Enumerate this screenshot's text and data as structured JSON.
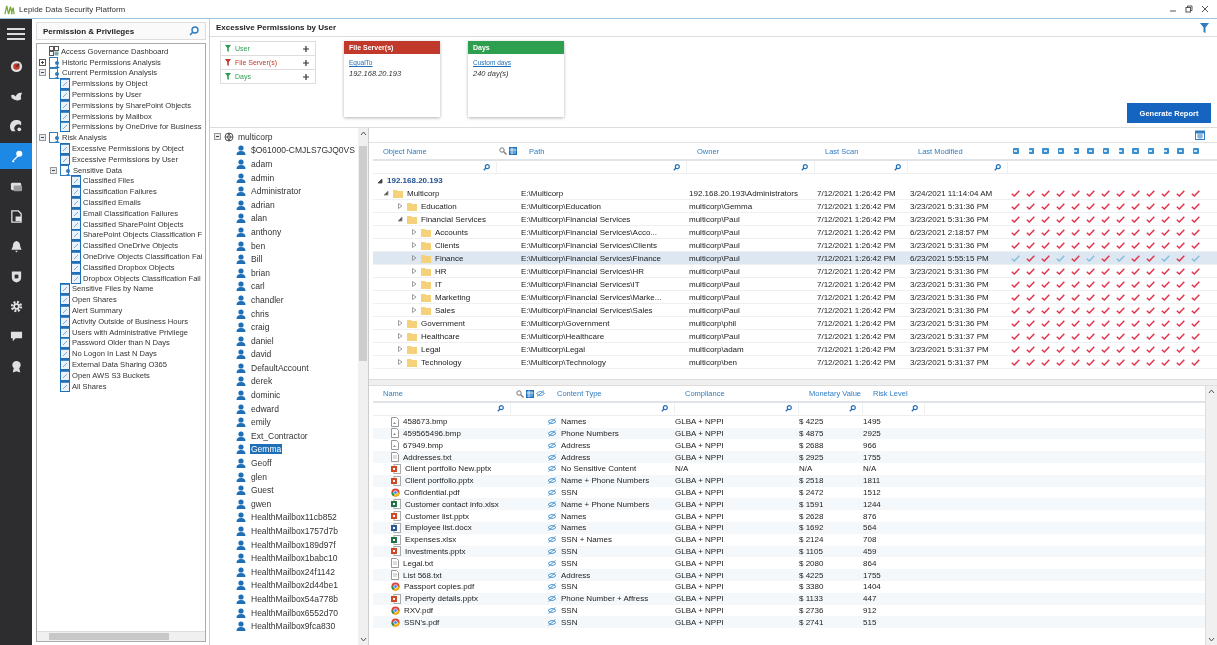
{
  "window": {
    "title": "Lepide Data Security Platform"
  },
  "nav": [
    {
      "kind": "gauge",
      "selected": false
    },
    {
      "kind": "bird",
      "selected": false
    },
    {
      "kind": "radar",
      "selected": false
    },
    {
      "kind": "key",
      "selected": true
    },
    {
      "kind": "database",
      "selected": false
    },
    {
      "kind": "report",
      "selected": false
    },
    {
      "kind": "bell",
      "selected": false
    },
    {
      "kind": "shield",
      "selected": false
    },
    {
      "kind": "gear",
      "selected": false
    },
    {
      "kind": "chat",
      "selected": false
    },
    {
      "kind": "badge",
      "selected": false
    }
  ],
  "left_panel": {
    "title": "Permission & Privileges",
    "tree": [
      {
        "label": "Access Governance Dashboard",
        "kind": "dashboard"
      },
      {
        "label": "Historic Permissions Analysis",
        "kind": "group",
        "expanded": false
      },
      {
        "label": "Current Permission Analysis",
        "kind": "group",
        "expanded": true,
        "children": [
          {
            "label": "Permissions by Object",
            "kind": "report"
          },
          {
            "label": "Permissions by User",
            "kind": "report"
          },
          {
            "label": "Permissions by SharePoint Objects",
            "kind": "report"
          },
          {
            "label": "Permissions by Mailbox",
            "kind": "report"
          },
          {
            "label": "Permissions by OneDrive for Business",
            "kind": "report"
          }
        ]
      },
      {
        "label": "Risk Analysis",
        "kind": "group",
        "expanded": true,
        "children": [
          {
            "label": "Excessive Permissions by Object",
            "kind": "report"
          },
          {
            "label": "Excessive Permissions by User",
            "kind": "report"
          },
          {
            "label": "Sensitive Data",
            "kind": "group",
            "expanded": true,
            "children": [
              {
                "label": "Classified Files",
                "kind": "report"
              },
              {
                "label": "Classification Failures",
                "kind": "report"
              },
              {
                "label": "Classified Emails",
                "kind": "report"
              },
              {
                "label": "Email Classification Failures",
                "kind": "report"
              },
              {
                "label": "Classified SharePoint Objects",
                "kind": "report"
              },
              {
                "label": "SharePoint Objects Classification F",
                "kind": "report"
              },
              {
                "label": "Classified OneDrive Objects",
                "kind": "report"
              },
              {
                "label": "OneDrive Objects Classification Fai",
                "kind": "report"
              },
              {
                "label": "Classified Dropbox Objects",
                "kind": "report"
              },
              {
                "label": "Dropbox Objects Classification Fail",
                "kind": "report"
              }
            ]
          },
          {
            "label": "Sensitive Files by Name",
            "kind": "report"
          },
          {
            "label": "Open Shares",
            "kind": "report"
          },
          {
            "label": "Alert Summary",
            "kind": "report"
          },
          {
            "label": "Activity Outside of Business Hours",
            "kind": "report"
          },
          {
            "label": "Users with Administrative Privilege",
            "kind": "report"
          },
          {
            "label": "Password Older than N Days",
            "kind": "report"
          },
          {
            "label": "No Logon In Last N Days",
            "kind": "report"
          },
          {
            "label": "External Data Sharing O365",
            "kind": "report"
          },
          {
            "label": "Open AWS S3 Buckets",
            "kind": "report"
          },
          {
            "label": "All Shares",
            "kind": "report"
          }
        ]
      }
    ]
  },
  "report": {
    "title": "Excessive Permissions by User",
    "filters": [
      {
        "label": "User",
        "color": "#2e9e4f"
      },
      {
        "label": "File Server(s)",
        "color": "#c0392b"
      },
      {
        "label": "Days",
        "color": "#2e9e4f"
      }
    ],
    "cards": [
      {
        "header": "File Server(s)",
        "color": "#c0392b",
        "operator": "EqualTo",
        "value": "192.168.20.193"
      },
      {
        "header": "Days",
        "color": "#2e9e4f",
        "operator": "Custom days",
        "value": "240 day(s)"
      }
    ],
    "generate_button": "Generate Report"
  },
  "users": {
    "root": "multicorp",
    "expanded": true,
    "items": [
      {
        "name": "$O61000-CMJLS7GJQ0VS",
        "selected": false
      },
      {
        "name": "adam",
        "selected": false
      },
      {
        "name": "admin",
        "selected": false
      },
      {
        "name": "Administrator",
        "selected": false
      },
      {
        "name": "adrian",
        "selected": false
      },
      {
        "name": "alan",
        "selected": false
      },
      {
        "name": "anthony",
        "selected": false
      },
      {
        "name": "ben",
        "selected": false
      },
      {
        "name": "Bill",
        "selected": false
      },
      {
        "name": "brian",
        "selected": false
      },
      {
        "name": "carl",
        "selected": false
      },
      {
        "name": "chandler",
        "selected": false
      },
      {
        "name": "chris",
        "selected": false
      },
      {
        "name": "craig",
        "selected": false
      },
      {
        "name": "daniel",
        "selected": false
      },
      {
        "name": "david",
        "selected": false
      },
      {
        "name": "DefaultAccount",
        "selected": false
      },
      {
        "name": "derek",
        "selected": false
      },
      {
        "name": "dominic",
        "selected": false
      },
      {
        "name": "edward",
        "selected": false
      },
      {
        "name": "emily",
        "selected": false
      },
      {
        "name": "Ext_Contractor",
        "selected": false
      },
      {
        "name": "Gemma",
        "selected": true
      },
      {
        "name": "Geoff",
        "selected": false
      },
      {
        "name": "glen",
        "selected": false
      },
      {
        "name": "Guest",
        "selected": false
      },
      {
        "name": "gwen",
        "selected": false
      },
      {
        "name": "HealthMailbox11cb852",
        "selected": false
      },
      {
        "name": "HealthMailbox1757d7b",
        "selected": false
      },
      {
        "name": "HealthMailbox189d97f",
        "selected": false
      },
      {
        "name": "HealthMailbox1babc10",
        "selected": false
      },
      {
        "name": "HealthMailbox24f1142",
        "selected": false
      },
      {
        "name": "HealthMailbox2d44be1",
        "selected": false
      },
      {
        "name": "HealthMailbox54a778b",
        "selected": false
      },
      {
        "name": "HealthMailbox6552d70",
        "selected": false
      },
      {
        "name": "HealthMailbox9fca830",
        "selected": false
      }
    ]
  },
  "objects": {
    "columns": [
      "Object Name",
      "Path",
      "Owner",
      "Last Scan",
      "Last Modified"
    ],
    "group": "192.168.20.193",
    "expanded": true,
    "rows": [
      {
        "name": "Multicorp",
        "path": "E:\\Multicorp",
        "owner": "192.168.20.193\\Administrators",
        "last_scan": "7/12/2021 1:26:42 PM",
        "last_modified": "3/24/2021 11:14:04 AM",
        "expanded": true,
        "selected": false,
        "checks": [
          true,
          true,
          true,
          true,
          true,
          true,
          true,
          true,
          true,
          true,
          true,
          true,
          true
        ],
        "children": [
          {
            "name": "Education",
            "path": "E:\\Multicorp\\Education",
            "owner": "multicorp\\Gemma",
            "last_scan": "7/12/2021 1:26:42 PM",
            "last_modified": "3/23/2021 5:31:36 PM",
            "expanded": false,
            "selected": false,
            "checks": [
              true,
              true,
              true,
              true,
              true,
              true,
              true,
              true,
              true,
              true,
              true,
              true,
              true
            ]
          },
          {
            "name": "Financial Services",
            "path": "E:\\Multicorp\\Financial Services",
            "owner": "multicorp\\Paul",
            "last_scan": "7/12/2021 1:26:42 PM",
            "last_modified": "3/23/2021 5:31:36 PM",
            "expanded": true,
            "selected": false,
            "checks": [
              true,
              true,
              true,
              true,
              true,
              true,
              true,
              true,
              true,
              true,
              true,
              true,
              true
            ],
            "children": [
              {
                "name": "Accounts",
                "path": "E:\\Multicorp\\Financial Services\\Acco...",
                "owner": "multicorp\\Paul",
                "last_scan": "7/12/2021 1:26:42 PM",
                "last_modified": "6/23/2021 2:18:57 PM",
                "expanded": false,
                "selected": false,
                "checks": [
                  true,
                  true,
                  true,
                  true,
                  true,
                  true,
                  true,
                  true,
                  true,
                  true,
                  true,
                  true,
                  true
                ]
              },
              {
                "name": "Clients",
                "path": "E:\\Multicorp\\Financial Services\\Clients",
                "owner": "multicorp\\Paul",
                "last_scan": "7/12/2021 1:26:42 PM",
                "last_modified": "3/23/2021 5:31:36 PM",
                "expanded": false,
                "selected": false,
                "checks": [
                  true,
                  true,
                  true,
                  true,
                  true,
                  true,
                  true,
                  true,
                  true,
                  true,
                  true,
                  true,
                  true
                ]
              },
              {
                "name": "Finance",
                "path": "E:\\Multicorp\\Financial Services\\Finance",
                "owner": "multicorp\\Paul",
                "last_scan": "7/12/2021 1:26:42 PM",
                "last_modified": "6/23/2021 5:55:15 PM",
                "expanded": false,
                "selected": true,
                "checks": [
                  false,
                  true,
                  true,
                  false,
                  true,
                  false,
                  true,
                  false,
                  true,
                  true,
                  false,
                  true,
                  false
                ]
              },
              {
                "name": "HR",
                "path": "E:\\Multicorp\\Financial Services\\HR",
                "owner": "multicorp\\Paul",
                "last_scan": "7/12/2021 1:26:42 PM",
                "last_modified": "3/23/2021 5:31:36 PM",
                "expanded": false,
                "selected": false,
                "checks": [
                  true,
                  true,
                  true,
                  true,
                  true,
                  true,
                  true,
                  true,
                  true,
                  true,
                  true,
                  true,
                  true
                ]
              },
              {
                "name": "IT",
                "path": "E:\\Multicorp\\Financial Services\\IT",
                "owner": "multicorp\\Paul",
                "last_scan": "7/12/2021 1:26:42 PM",
                "last_modified": "3/23/2021 5:31:36 PM",
                "expanded": false,
                "selected": false,
                "checks": [
                  true,
                  true,
                  true,
                  true,
                  true,
                  true,
                  true,
                  true,
                  true,
                  true,
                  true,
                  true,
                  true
                ]
              },
              {
                "name": "Marketing",
                "path": "E:\\Multicorp\\Financial Services\\Marke...",
                "owner": "multicorp\\Paul",
                "last_scan": "7/12/2021 1:26:42 PM",
                "last_modified": "3/23/2021 5:31:36 PM",
                "expanded": false,
                "selected": false,
                "checks": [
                  true,
                  true,
                  true,
                  true,
                  true,
                  true,
                  true,
                  true,
                  true,
                  true,
                  true,
                  true,
                  true
                ]
              },
              {
                "name": "Sales",
                "path": "E:\\Multicorp\\Financial Services\\Sales",
                "owner": "multicorp\\Paul",
                "last_scan": "7/12/2021 1:26:42 PM",
                "last_modified": "3/23/2021 5:31:36 PM",
                "expanded": false,
                "selected": false,
                "checks": [
                  true,
                  true,
                  true,
                  true,
                  true,
                  true,
                  true,
                  true,
                  true,
                  true,
                  true,
                  true,
                  true
                ]
              }
            ]
          },
          {
            "name": "Government",
            "path": "E:\\Multicorp\\Government",
            "owner": "multicorp\\phil",
            "last_scan": "7/12/2021 1:26:42 PM",
            "last_modified": "3/23/2021 5:31:36 PM",
            "expanded": false,
            "selected": false,
            "checks": [
              true,
              true,
              true,
              true,
              true,
              true,
              true,
              true,
              true,
              true,
              true,
              true,
              true
            ]
          },
          {
            "name": "Healthcare",
            "path": "E:\\Multicorp\\Healthcare",
            "owner": "multicorp\\Paul",
            "last_scan": "7/12/2021 1:26:42 PM",
            "last_modified": "3/23/2021 5:31:37 PM",
            "expanded": false,
            "selected": false,
            "checks": [
              true,
              true,
              true,
              true,
              true,
              true,
              true,
              true,
              true,
              true,
              true,
              true,
              true
            ]
          },
          {
            "name": "Legal",
            "path": "E:\\Multicorp\\Legal",
            "owner": "multicorp\\adam",
            "last_scan": "7/12/2021 1:26:42 PM",
            "last_modified": "3/23/2021 5:31:37 PM",
            "expanded": false,
            "selected": false,
            "checks": [
              true,
              true,
              true,
              true,
              true,
              true,
              true,
              true,
              true,
              true,
              true,
              true,
              true
            ]
          },
          {
            "name": "Technology",
            "path": "E:\\Multicorp\\Technology",
            "owner": "multicorp\\ben",
            "last_scan": "7/12/2021 1:26:42 PM",
            "last_modified": "3/23/2021 5:31:37 PM",
            "expanded": false,
            "selected": false,
            "checks": [
              true,
              true,
              true,
              true,
              true,
              true,
              true,
              true,
              true,
              true,
              true,
              true,
              true
            ]
          }
        ]
      }
    ]
  },
  "files": {
    "columns": [
      "Name",
      "Content Type",
      "Compliance",
      "Monetary Value",
      "Risk Level"
    ],
    "rows": [
      {
        "name": "458673.bmp",
        "kind": "image",
        "content": "Names",
        "compliance": "GLBA + NPPI",
        "value": "$ 4225",
        "risk": "1495"
      },
      {
        "name": "459565496.bmp",
        "kind": "image",
        "content": "Phone Numbers",
        "compliance": "GLBA + NPPI",
        "value": "$ 4875",
        "risk": "2925"
      },
      {
        "name": "67949.bmp",
        "kind": "image",
        "content": "Address",
        "compliance": "GLBA + NPPI",
        "value": "$ 2688",
        "risk": "966"
      },
      {
        "name": "Addresses.txt",
        "kind": "text",
        "content": "Address",
        "compliance": "GLBA + NPPI",
        "value": "$ 2925",
        "risk": "1755"
      },
      {
        "name": "Client portfolio New.pptx",
        "kind": "slides",
        "content": "No Sensitive Content",
        "compliance": "N/A",
        "value": "N/A",
        "risk": "N/A"
      },
      {
        "name": "Client portfolio.pptx",
        "kind": "slides",
        "content": "Name + Phone Numbers",
        "compliance": "GLBA + NPPI",
        "value": "$ 2518",
        "risk": "1811"
      },
      {
        "name": "Confidential.pdf",
        "kind": "pdf",
        "content": "SSN",
        "compliance": "GLBA + NPPI",
        "value": "$ 2472",
        "risk": "1512"
      },
      {
        "name": "Customer contact info.xlsx",
        "kind": "sheet",
        "content": "Name + Phone Numbers",
        "compliance": "GLBA + NPPI",
        "value": "$ 1591",
        "risk": "1244"
      },
      {
        "name": "Customer list.pptx",
        "kind": "slides",
        "content": "Names",
        "compliance": "GLBA + NPPI",
        "value": "$ 2628",
        "risk": "876"
      },
      {
        "name": "Employee list.docx",
        "kind": "doc",
        "content": "Names",
        "compliance": "GLBA + NPPI",
        "value": "$ 1692",
        "risk": "564"
      },
      {
        "name": "Expenses.xlsx",
        "kind": "sheet",
        "content": "SSN + Names",
        "compliance": "GLBA + NPPI",
        "value": "$ 2124",
        "risk": "708"
      },
      {
        "name": "Investments.pptx",
        "kind": "slides",
        "content": "SSN",
        "compliance": "GLBA + NPPI",
        "value": "$ 1105",
        "risk": "459"
      },
      {
        "name": "Legal.txt",
        "kind": "text",
        "content": "SSN",
        "compliance": "GLBA + NPPI",
        "value": "$ 2080",
        "risk": "864"
      },
      {
        "name": "List 568.txt",
        "kind": "text",
        "content": "Address",
        "compliance": "GLBA + NPPI",
        "value": "$ 4225",
        "risk": "1755"
      },
      {
        "name": "Passport copies.pdf",
        "kind": "pdf",
        "content": "SSN",
        "compliance": "GLBA + NPPI",
        "value": "$ 3380",
        "risk": "1404"
      },
      {
        "name": "Property details.pptx",
        "kind": "slides",
        "content": "Phone Number + Affress",
        "compliance": "GLBA + NPPI",
        "value": "$ 1133",
        "risk": "447"
      },
      {
        "name": "RXV.pdf",
        "kind": "pdf",
        "content": "SSN",
        "compliance": "GLBA + NPPI",
        "value": "$ 2736",
        "risk": "912"
      },
      {
        "name": "SSN's.pdf",
        "kind": "pdf",
        "content": "SSN",
        "compliance": "GLBA + NPPI",
        "value": "$ 2741",
        "risk": "515"
      }
    ]
  }
}
